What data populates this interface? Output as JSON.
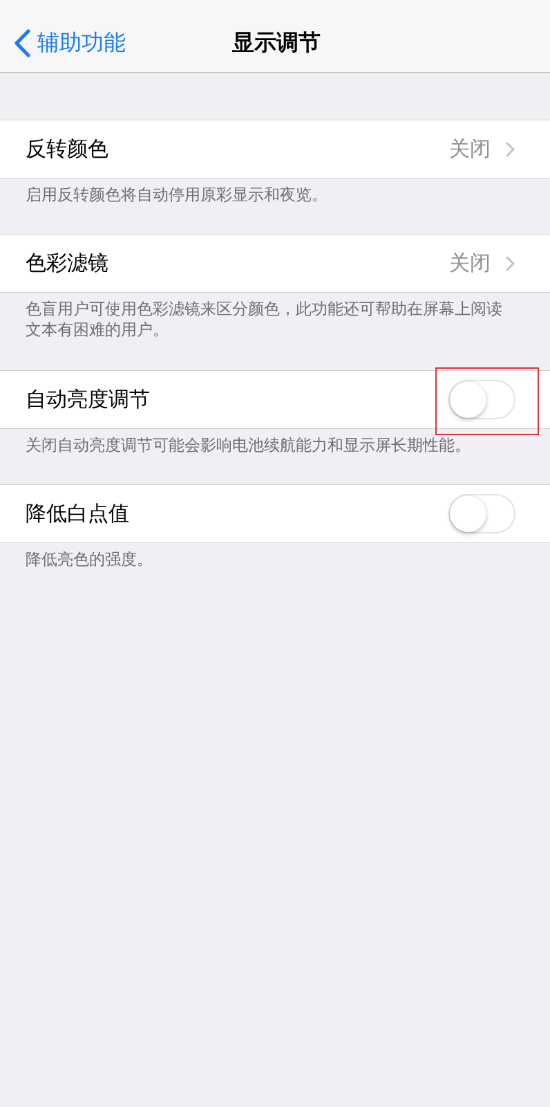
{
  "nav_bar": {
    "back_label": "辅助功能",
    "title": "显示调节"
  },
  "sections": [
    {
      "kind": "disclosure",
      "label": "反转颜色",
      "value": "关闭",
      "highlighted": false,
      "footer": "启用反转颜色将自动停用原彩显示和夜览。"
    },
    {
      "kind": "disclosure",
      "label": "色彩滤镜",
      "value": "关闭",
      "highlighted": false,
      "footer": "色盲用户可使用色彩滤镜来区分颜色，此功能还可帮助在屏幕上阅读文本有困难的用户。"
    },
    {
      "kind": "toggle",
      "label": "自动亮度调节",
      "on": false,
      "highlighted": true,
      "footer": "关闭自动亮度调节可能会影响电池续航能力和显示屏长期性能。"
    },
    {
      "kind": "toggle",
      "label": "降低白点值",
      "on": false,
      "highlighted": false,
      "footer": "降低亮色的强度。"
    }
  ]
}
